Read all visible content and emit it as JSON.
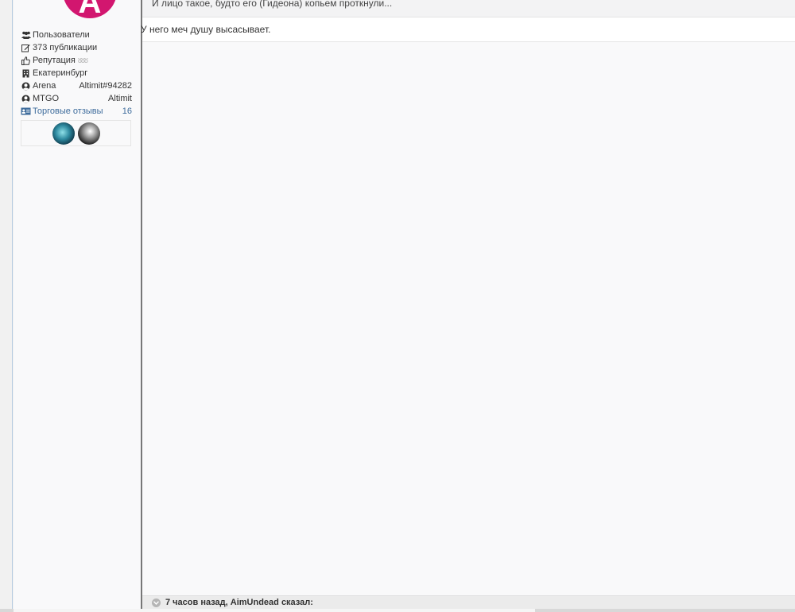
{
  "author": {
    "avatar_letter": "A",
    "avatar_color": "#d2166f",
    "group": "Пользователи",
    "posts": "373 публикации",
    "reputation_label": "Репутация",
    "reputation_stars": "ᴕᴕᴕ",
    "city": "Екатеринбург",
    "arena_label": "Arena",
    "arena_value": "Altimit#94282",
    "mtgo_label": "MTGO",
    "mtgo_value": "Altimit",
    "trade_label": "Торговые отзывы",
    "trade_value": "16"
  },
  "post": {
    "quote_text": "И лицо такое, будто его (Гидеона) копьем проткнули...",
    "text": "У него меч душу высасывает."
  },
  "next_quote": {
    "label": "7 часов назад, AimUndead сказал:"
  },
  "colors": {
    "link": "#3e6c9c",
    "divider": "#777777"
  }
}
